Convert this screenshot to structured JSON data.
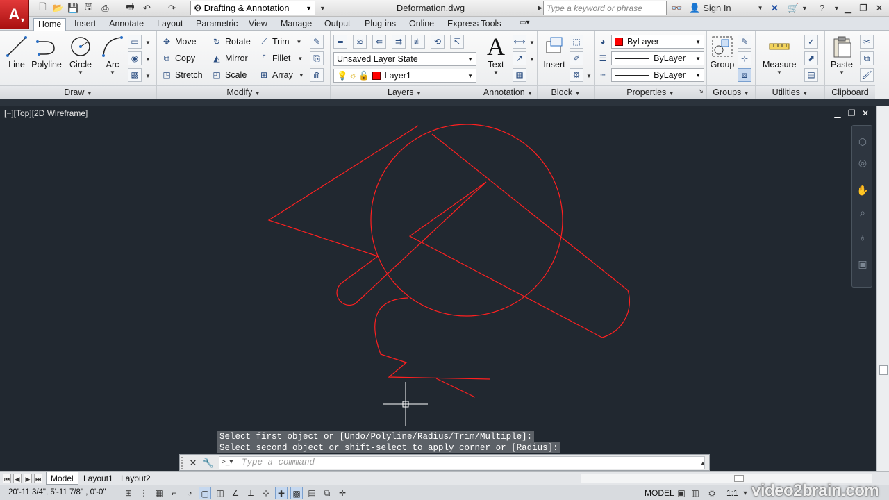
{
  "app": {
    "logo_letter": "A",
    "workspace": "Drafting & Annotation",
    "document_title": "Deformation.dwg",
    "search_placeholder": "Type a keyword or phrase",
    "sign_in": "Sign In"
  },
  "ribbon_tabs": [
    "Home",
    "Insert",
    "Annotate",
    "Layout",
    "Parametric",
    "View",
    "Manage",
    "Output",
    "Plug-ins",
    "Online",
    "Express Tools"
  ],
  "panels": {
    "draw": {
      "title": "Draw",
      "line": "Line",
      "polyline": "Polyline",
      "circle": "Circle",
      "arc": "Arc"
    },
    "modify": {
      "title": "Modify",
      "move": "Move",
      "rotate": "Rotate",
      "trim": "Trim",
      "copy": "Copy",
      "mirror": "Mirror",
      "fillet": "Fillet",
      "stretch": "Stretch",
      "scale": "Scale",
      "array": "Array"
    },
    "layers": {
      "title": "Layers",
      "layer_state": "Unsaved Layer State",
      "current_layer": "Layer1"
    },
    "annotation": {
      "title": "Annotation",
      "text": "Text"
    },
    "block": {
      "title": "Block",
      "insert": "Insert"
    },
    "properties": {
      "title": "Properties",
      "color": "ByLayer",
      "linetype": "ByLayer",
      "lineweight": "ByLayer"
    },
    "groups": {
      "title": "Groups",
      "group": "Group"
    },
    "utilities": {
      "title": "Utilities",
      "measure": "Measure"
    },
    "clipboard": {
      "title": "Clipboard",
      "paste": "Paste"
    }
  },
  "viewport": {
    "label": "[−][Top][2D Wireframe]"
  },
  "command": {
    "history": [
      "Select first object or [Undo/Polyline/Radius/Trim/Multiple]:",
      "Select second object or shift-select to apply corner or [Radius]:"
    ],
    "placeholder": "Type a command"
  },
  "layout_tabs": [
    "Model",
    "Layout1",
    "Layout2"
  ],
  "status": {
    "coordinates": "20'-11 3/4\",  5'-11 7/8\" , 0'-0\"",
    "model": "MODEL",
    "scale": "1:1"
  },
  "watermark": "video2brain.com",
  "colors": {
    "drawing_bg": "#212830",
    "geometry": "#ff0000",
    "ribbon_bg": "#f0f1f3",
    "accent_red": "#c41e1e"
  }
}
